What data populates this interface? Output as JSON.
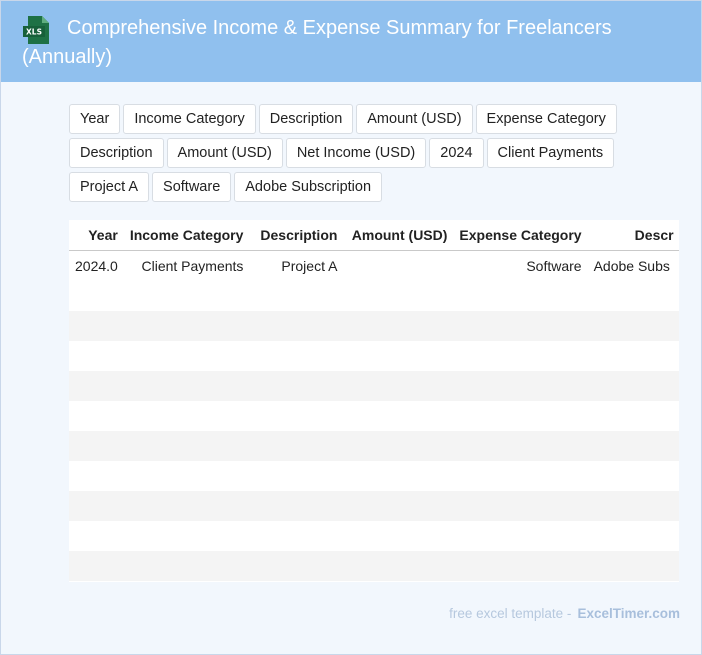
{
  "header": {
    "icon_name": "xls-file-icon",
    "icon_label": "XLS",
    "title": "Comprehensive Income & Expense Summary for Freelancers (Annually)"
  },
  "chips": [
    "Year",
    "Income Category",
    "Description",
    "Amount (USD)",
    "Expense Category",
    "Description",
    "Amount (USD)",
    "Net Income (USD)",
    "2024",
    "Client Payments",
    "Project A",
    "Software",
    "Adobe Subscription"
  ],
  "table": {
    "columns": [
      "Year",
      "Income Category",
      "Description",
      "Amount (USD)",
      "Expense Category",
      "Descr"
    ],
    "row_indices": [
      "0",
      "1",
      "2",
      "3",
      "4",
      "5",
      "6",
      "7",
      "8",
      "9",
      "0"
    ],
    "rows": [
      [
        "2024.0",
        "Client Payments",
        "Project A",
        "",
        "Software",
        "Adobe Subs"
      ],
      [
        "",
        "",
        "",
        "",
        "",
        ""
      ],
      [
        "",
        "",
        "",
        "",
        "",
        ""
      ],
      [
        "",
        "",
        "",
        "",
        "",
        ""
      ],
      [
        "",
        "",
        "",
        "",
        "",
        ""
      ],
      [
        "",
        "",
        "",
        "",
        "",
        ""
      ],
      [
        "",
        "",
        "",
        "",
        "",
        ""
      ],
      [
        "",
        "",
        "",
        "",
        "",
        ""
      ],
      [
        "",
        "",
        "",
        "",
        "",
        ""
      ],
      [
        "",
        "",
        "",
        "",
        "",
        ""
      ],
      [
        "",
        "",
        "",
        "",
        "",
        ""
      ]
    ]
  },
  "footer": {
    "text": "free excel template -",
    "brand": "ExcelTimer.com"
  },
  "colors": {
    "header_bg": "#90c0ee",
    "page_bg": "#f2f7fd",
    "icon_green": "#1e7145"
  }
}
